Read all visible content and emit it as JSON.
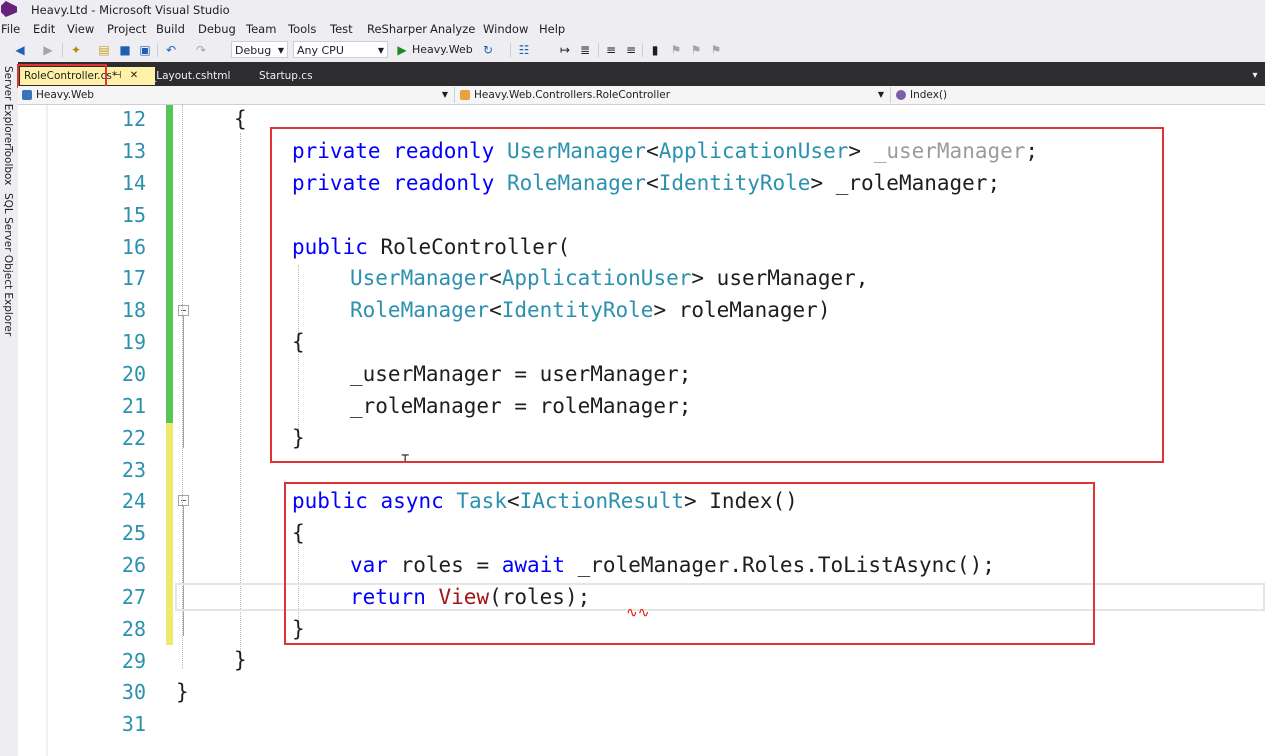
{
  "window": {
    "title": "Heavy.Ltd - Microsoft Visual Studio"
  },
  "menu": [
    "File",
    "Edit",
    "View",
    "Project",
    "Build",
    "Debug",
    "Team",
    "Tools",
    "Test",
    "ReSharper",
    "Analyze",
    "Window",
    "Help"
  ],
  "toolbar": {
    "config": "Debug",
    "platform": "Any CPU",
    "run_target": "Heavy.Web",
    "icons": [
      "back-icon",
      "forward-icon",
      "new-project-icon",
      "open-icon",
      "save-icon",
      "save-all-icon",
      "undo-icon",
      "redo-icon",
      "start-icon",
      "refresh-icon",
      "attach-icon",
      "bookmark-icon"
    ]
  },
  "left_dock": {
    "tabs": [
      "Server Explorer",
      "Toolbox",
      "SQL Server Object Explorer"
    ]
  },
  "tabs": [
    {
      "label": "RoleController.cs*",
      "active": true
    },
    {
      "label": "_Layout.cshtml",
      "active": false
    },
    {
      "label": "Startup.cs",
      "active": false
    }
  ],
  "navbar": {
    "project": "Heavy.Web",
    "class": "Heavy.Web.Controllers.RoleController",
    "member": "Index()"
  },
  "editor": {
    "line_numbers": [
      "12",
      "13",
      "14",
      "15",
      "16",
      "17",
      "18",
      "19",
      "20",
      "21",
      "22",
      "23",
      "24",
      "25",
      "26",
      "27",
      "28",
      "29",
      "30",
      "31"
    ],
    "code": {
      "l12": "{",
      "l13_kw1": "private",
      "l13_kw2": "readonly",
      "l13_type1": "UserManager",
      "l13_lt": "<",
      "l13_type2": "ApplicationUser",
      "l13_gt": ">",
      "l13_field": "_userManager",
      "l13_semi": ";",
      "l14_kw1": "private",
      "l14_kw2": "readonly",
      "l14_type1": "RoleManager",
      "l14_lt": "<",
      "l14_type2": "IdentityRole",
      "l14_rest": "> _roleManager;",
      "l16_kw": "public",
      "l16_rest": "RoleController(",
      "l17_type1": "UserManager",
      "l17_lt": "<",
      "l17_type2": "ApplicationUser",
      "l17_rest": "> userManager,",
      "l18_type1": "RoleManager",
      "l18_lt": "<",
      "l18_type2": "IdentityRole",
      "l18_rest": "> roleManager)",
      "l19": "{",
      "l20": "_userManager = userManager;",
      "l21": "_roleManager = roleManager;",
      "l22": "}",
      "l24_kw1": "public",
      "l24_kw2": "async",
      "l24_type1": "Task",
      "l24_lt": "<",
      "l24_type2": "IActionResult",
      "l24_rest": "> Index()",
      "l25": "{",
      "l26_kw1": "var",
      "l26_mid": "roles =",
      "l26_kw2": "await",
      "l26_rest": "_roleManager.Roles.ToListAsync();",
      "l27_kw": "return",
      "l27_meth": "View",
      "l27_rest": "(roles);",
      "l28": "}",
      "l29": "}",
      "l30": "}"
    }
  },
  "colors": {
    "keyword": "#0000ff",
    "type": "#2b91af",
    "highlight_box": "#e03434",
    "saved_change": "#57c657",
    "unsaved_change": "#f0ea6c"
  }
}
